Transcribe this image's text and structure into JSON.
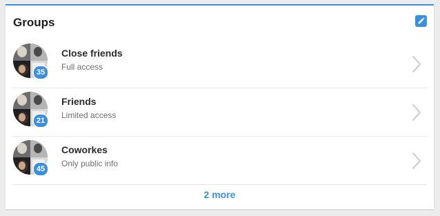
{
  "panel": {
    "title": "Groups",
    "more_label": "2 more"
  },
  "colors": {
    "accent": "#3d8fd9",
    "title": "#1e1e1e",
    "subtitle": "#6e6e6e",
    "divider": "#e6e6e6",
    "chevron": "#cfcfcf"
  },
  "groups": [
    {
      "name": "Close friends",
      "access": "Full access",
      "count": "35"
    },
    {
      "name": "Friends",
      "access": "Limited access",
      "count": "21"
    },
    {
      "name": "Coworkes",
      "access": "Only public info",
      "count": "45"
    }
  ]
}
